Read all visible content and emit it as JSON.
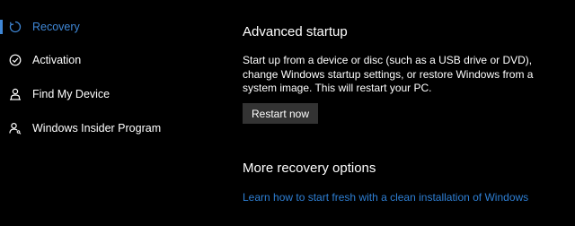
{
  "sidebar": {
    "items": [
      {
        "label": "Recovery",
        "icon": "recovery-icon",
        "selected": true
      },
      {
        "label": "Activation",
        "icon": "check-circle-icon",
        "selected": false
      },
      {
        "label": "Find My Device",
        "icon": "person-location-icon",
        "selected": false
      },
      {
        "label": "Windows Insider Program",
        "icon": "insider-icon",
        "selected": false
      }
    ]
  },
  "main": {
    "advanced_startup": {
      "title": "Advanced startup",
      "description": "Start up from a device or disc (such as a USB drive or DVD), change Windows startup settings, or restore Windows from a system image. This will restart your PC.",
      "button_label": "Restart now"
    },
    "more_recovery": {
      "title": "More recovery options",
      "link_text": "Learn how to start fresh with a clean installation of Windows"
    }
  },
  "colors": {
    "background": "#000000",
    "accent": "#3f87d6",
    "link": "#2e7fd4",
    "button_bg": "#333333"
  }
}
